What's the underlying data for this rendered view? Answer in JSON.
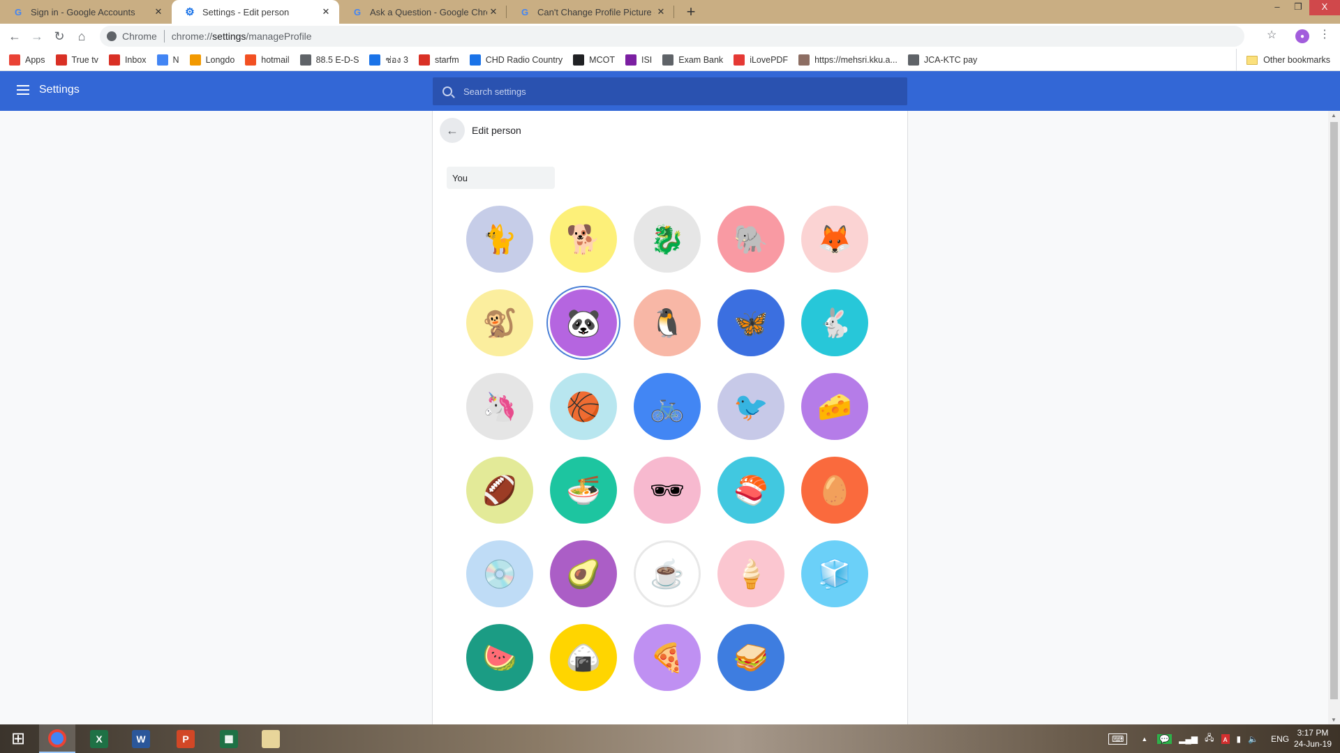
{
  "tabs": [
    {
      "title": "Sign in - Google Accounts",
      "icon": "google-icon",
      "active": false
    },
    {
      "title": "Settings - Edit person",
      "icon": "settings-gear-icon",
      "active": true
    },
    {
      "title": "Ask a Question - Google Chrome",
      "icon": "google-icon",
      "active": false
    },
    {
      "title": "Can't Change Profile Picture - Go",
      "icon": "google-icon",
      "active": false
    }
  ],
  "window_controls": {
    "minimize": "–",
    "restore": "❐",
    "close": "X"
  },
  "toolbar": {
    "origin_label": "Chrome",
    "url_prefix": "chrome://",
    "url_host": "settings",
    "url_path": "/manageProfile"
  },
  "bookmarks": [
    {
      "label": "Apps",
      "icon": "apps-grid-icon",
      "color": "#e94235"
    },
    {
      "label": "True tv",
      "icon": "truetv-icon",
      "color": "#d93025"
    },
    {
      "label": "Inbox",
      "icon": "gmail-icon",
      "color": "#d93025"
    },
    {
      "label": "N",
      "icon": "docs-icon",
      "color": "#4285f4"
    },
    {
      "label": "Longdo",
      "icon": "longdo-icon",
      "color": "#f29900"
    },
    {
      "label": "hotmail",
      "icon": "microsoft-icon",
      "color": "#f25022"
    },
    {
      "label": "88.5 E-D-S",
      "icon": "globe-icon",
      "color": "#5f6368"
    },
    {
      "label": "ช่อง 3",
      "icon": "ch3-icon",
      "color": "#1a73e8"
    },
    {
      "label": "starfm",
      "icon": "starfm-icon",
      "color": "#d93025"
    },
    {
      "label": "CHD Radio Country",
      "icon": "bolt-icon",
      "color": "#1a73e8"
    },
    {
      "label": "MCOT",
      "icon": "mcot-icon",
      "color": "#202124"
    },
    {
      "label": "ISI",
      "icon": "isi-icon",
      "color": "#7b1fa2"
    },
    {
      "label": "Exam Bank",
      "icon": "globe-icon",
      "color": "#5f6368"
    },
    {
      "label": "iLovePDF",
      "icon": "ilovepdf-icon",
      "color": "#e53935"
    },
    {
      "label": "https://mehsri.kku.a...",
      "icon": "site-icon",
      "color": "#8d6e63"
    },
    {
      "label": "JCA-KTC pay",
      "icon": "globe-icon",
      "color": "#5f6368"
    }
  ],
  "other_bookmarks": "Other bookmarks",
  "settings": {
    "title": "Settings",
    "search_placeholder": "Search settings"
  },
  "page": {
    "title": "Edit person",
    "name_value": "You",
    "selected_avatar": "panda",
    "avatars": [
      {
        "name": "cat",
        "bg": "#c6cde8",
        "glyph": "🐈"
      },
      {
        "name": "corgi",
        "bg": "#fdf079",
        "glyph": "🐕"
      },
      {
        "name": "dragon",
        "bg": "#e6e6e6",
        "glyph": "🐉"
      },
      {
        "name": "elephant",
        "bg": "#f99aa3",
        "glyph": "🐘"
      },
      {
        "name": "fox",
        "bg": "#fbd3d3",
        "glyph": "🦊"
      },
      {
        "name": "monkey",
        "bg": "#fbee9e",
        "glyph": "🐒"
      },
      {
        "name": "panda",
        "bg": "#b565e0",
        "glyph": "🐼"
      },
      {
        "name": "penguin",
        "bg": "#f8b7a6",
        "glyph": "🐧"
      },
      {
        "name": "butterfly",
        "bg": "#3b6fe0",
        "glyph": "🦋"
      },
      {
        "name": "rabbit",
        "bg": "#27c7d9",
        "glyph": "🐇"
      },
      {
        "name": "unicorn",
        "bg": "#e5e5e5",
        "glyph": "🦄"
      },
      {
        "name": "basketball",
        "bg": "#b8e6ef",
        "glyph": "🏀"
      },
      {
        "name": "bike",
        "bg": "#4286f4",
        "glyph": "🚲"
      },
      {
        "name": "bird",
        "bg": "#c7c9e8",
        "glyph": "🐦"
      },
      {
        "name": "cheese",
        "bg": "#b57ce8",
        "glyph": "🧀"
      },
      {
        "name": "football",
        "bg": "#e3ea98",
        "glyph": "🏈"
      },
      {
        "name": "ramen",
        "bg": "#1dc5a0",
        "glyph": "🍜"
      },
      {
        "name": "sunglasses",
        "bg": "#f7b9cf",
        "glyph": "🕶"
      },
      {
        "name": "sushi",
        "bg": "#41c8e0",
        "glyph": "🍣"
      },
      {
        "name": "tamagotchi",
        "bg": "#fa6a3d",
        "glyph": "🥚"
      },
      {
        "name": "vinyl",
        "bg": "#bfdcf6",
        "glyph": "💿"
      },
      {
        "name": "avocado",
        "bg": "#ab5ec6",
        "glyph": "🥑"
      },
      {
        "name": "cappuccino",
        "bg": "#ffffff",
        "glyph": "☕"
      },
      {
        "name": "icecream",
        "bg": "#fbc6d0",
        "glyph": "🍦"
      },
      {
        "name": "ice",
        "bg": "#6bd0f8",
        "glyph": "🧊"
      },
      {
        "name": "watermelon",
        "bg": "#1b9c84",
        "glyph": "🍉"
      },
      {
        "name": "onigiri",
        "bg": "#ffd500",
        "glyph": "🍙"
      },
      {
        "name": "pizza",
        "bg": "#bf90f2",
        "glyph": "🍕"
      },
      {
        "name": "sandwich",
        "bg": "#3e7de0",
        "glyph": "🥪"
      }
    ]
  },
  "taskbar": {
    "apps": [
      {
        "name": "start",
        "label": "⊞",
        "color": "transparent"
      },
      {
        "name": "chrome",
        "label": "◉",
        "color": "#4285f4"
      },
      {
        "name": "excel",
        "label": "X",
        "color": "#1e7145"
      },
      {
        "name": "word",
        "label": "W",
        "color": "#2b579a"
      },
      {
        "name": "powerpoint",
        "label": "P",
        "color": "#d24726"
      },
      {
        "name": "calculator",
        "label": "▦",
        "color": "#1e7145"
      },
      {
        "name": "file-explorer",
        "label": "📁",
        "color": "transparent"
      }
    ],
    "language": "ENG",
    "time": "3:17 PM",
    "date": "24-Jun-19"
  }
}
